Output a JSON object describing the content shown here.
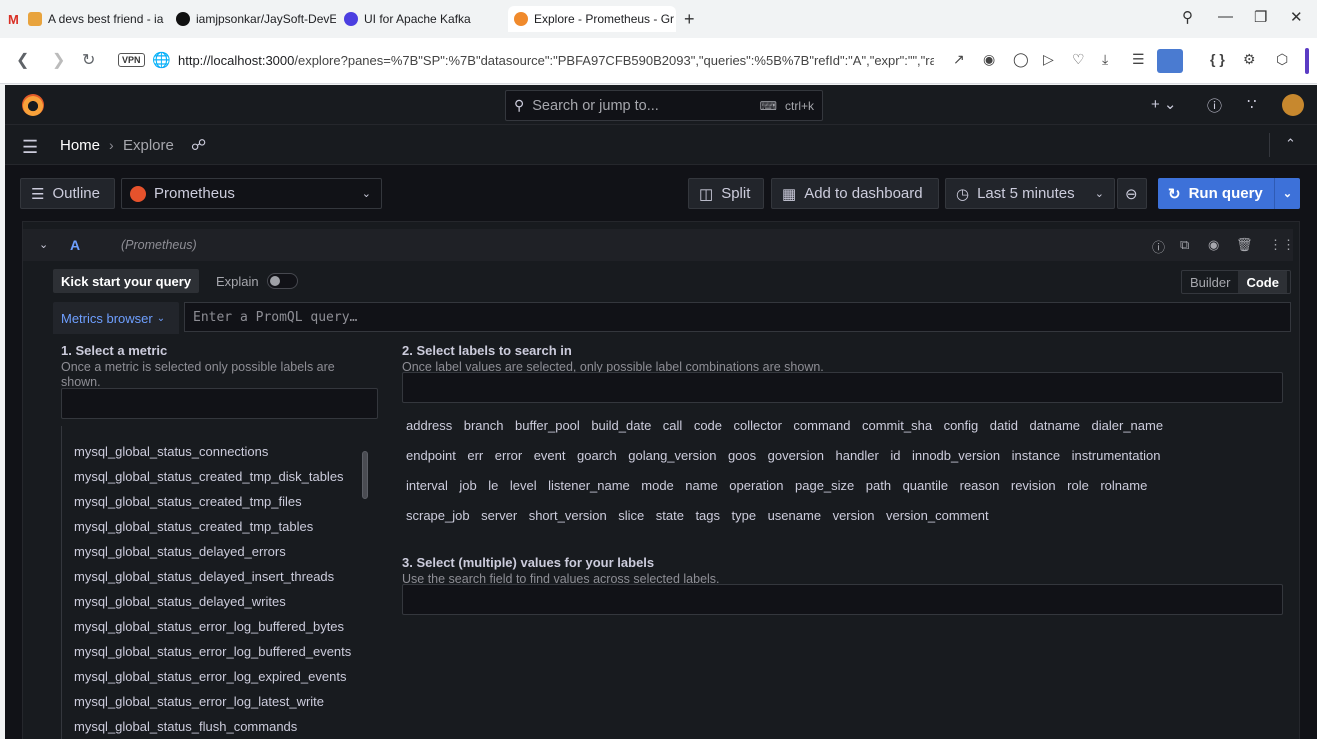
{
  "browser": {
    "tabs": [
      {
        "label": "A devs best friend - ia"
      },
      {
        "label": "iamjpsonkar/JaySoft-DevE"
      },
      {
        "label": "UI for Apache Kafka"
      },
      {
        "label": "Explore - Prometheus - Gr"
      }
    ],
    "url_host": "http://localhost:3000",
    "url_path": "/explore?panes=%7B\"SP\":%7B\"datasource\":\"PBFA97CFB590B2093\",\"queries\":%5B%7B\"refId\":\"A\",\"expr\":\"\",\"rang",
    "vpn_label": "VPN"
  },
  "topnav": {
    "search_placeholder": "Search or jump to...",
    "search_shortcut": "ctrl+k"
  },
  "breadcrumb": {
    "home": "Home",
    "current": "Explore"
  },
  "toolbar": {
    "outline": "Outline",
    "datasource": "Prometheus",
    "split": "Split",
    "add_to_dashboard": "Add to dashboard",
    "time_range": "Last 5 minutes",
    "run_query": "Run query"
  },
  "query": {
    "ref_id": "A",
    "datasource_hint": "(Prometheus)",
    "kick_start": "Kick start your query",
    "explain": "Explain",
    "mode_builder": "Builder",
    "mode_code": "Code",
    "metrics_browser": "Metrics browser",
    "promql_placeholder": "Enter a PromQL query…"
  },
  "metrics_browser": {
    "step1_title": "1. Select a metric",
    "step1_desc": "Once a metric is selected only possible labels are shown.",
    "step2_title": "2. Select labels to search in",
    "step2_desc": "Once label values are selected, only possible label combinations are shown.",
    "step3_title": "3. Select (multiple) values for your labels",
    "step3_desc": "Use the search field to find values across selected labels.",
    "metrics": [
      "mysql_global_status_connections",
      "mysql_global_status_created_tmp_disk_tables",
      "mysql_global_status_created_tmp_files",
      "mysql_global_status_created_tmp_tables",
      "mysql_global_status_delayed_errors",
      "mysql_global_status_delayed_insert_threads",
      "mysql_global_status_delayed_writes",
      "mysql_global_status_error_log_buffered_bytes",
      "mysql_global_status_error_log_buffered_events",
      "mysql_global_status_error_log_expired_events",
      "mysql_global_status_error_log_latest_write",
      "mysql_global_status_flush_commands"
    ],
    "label_rows": [
      [
        "address",
        "branch",
        "buffer_pool",
        "build_date",
        "call",
        "code",
        "collector",
        "command",
        "commit_sha",
        "config",
        "datid",
        "datname",
        "dialer_name"
      ],
      [
        "endpoint",
        "err",
        "error",
        "event",
        "goarch",
        "golang_version",
        "goos",
        "goversion",
        "handler",
        "id",
        "innodb_version",
        "instance",
        "instrumentation"
      ],
      [
        "interval",
        "job",
        "le",
        "level",
        "listener_name",
        "mode",
        "name",
        "operation",
        "page_size",
        "path",
        "quantile",
        "reason",
        "revision",
        "role",
        "rolname"
      ],
      [
        "scrape_job",
        "server",
        "short_version",
        "slice",
        "state",
        "tags",
        "type",
        "usename",
        "version",
        "version_comment"
      ]
    ]
  }
}
